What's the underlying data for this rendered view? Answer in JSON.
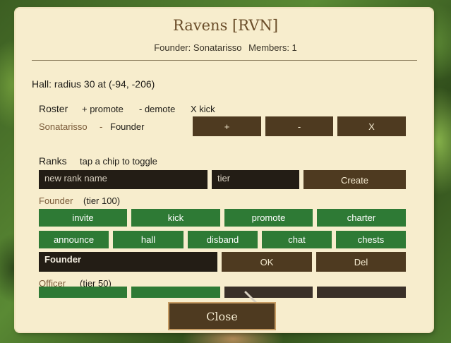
{
  "header": {
    "title": "Ravens [RVN]",
    "founder": "Founder: Sonatarisso",
    "members": "Members: 1"
  },
  "hall": "Hall: radius 30 at (-94, -206)",
  "roster": {
    "heading": "Roster",
    "hints": [
      "+ promote",
      "- demote",
      "X kick"
    ],
    "member": {
      "name": "Sonatarisso",
      "separator": "-",
      "rank": "Founder"
    },
    "buttons": {
      "promote": "+",
      "demote": "-",
      "kick": "X"
    }
  },
  "ranks": {
    "heading": "Ranks",
    "hint": "tap a chip to toggle",
    "new_rank_placeholder": "new rank name",
    "tier_placeholder": "tier",
    "create_label": "Create",
    "list": [
      {
        "label": "Founder",
        "tier": "(tier 100)",
        "chips_row1": [
          "invite",
          "kick",
          "promote",
          "charter"
        ],
        "chips_row2": [
          "announce",
          "hall",
          "disband",
          "chat",
          "chests"
        ],
        "name_value": "Founder",
        "ok_label": "OK",
        "del_label": "Del"
      },
      {
        "label": "Officer",
        "tier": "(tier 50)"
      }
    ]
  },
  "close_label": "Close",
  "colors": {
    "parchment": "#f7edcd",
    "button_brown": "#4e3a20",
    "chip_green": "#2e7a35",
    "title_brown": "#6b4e2a",
    "input_dark": "#231d15"
  }
}
